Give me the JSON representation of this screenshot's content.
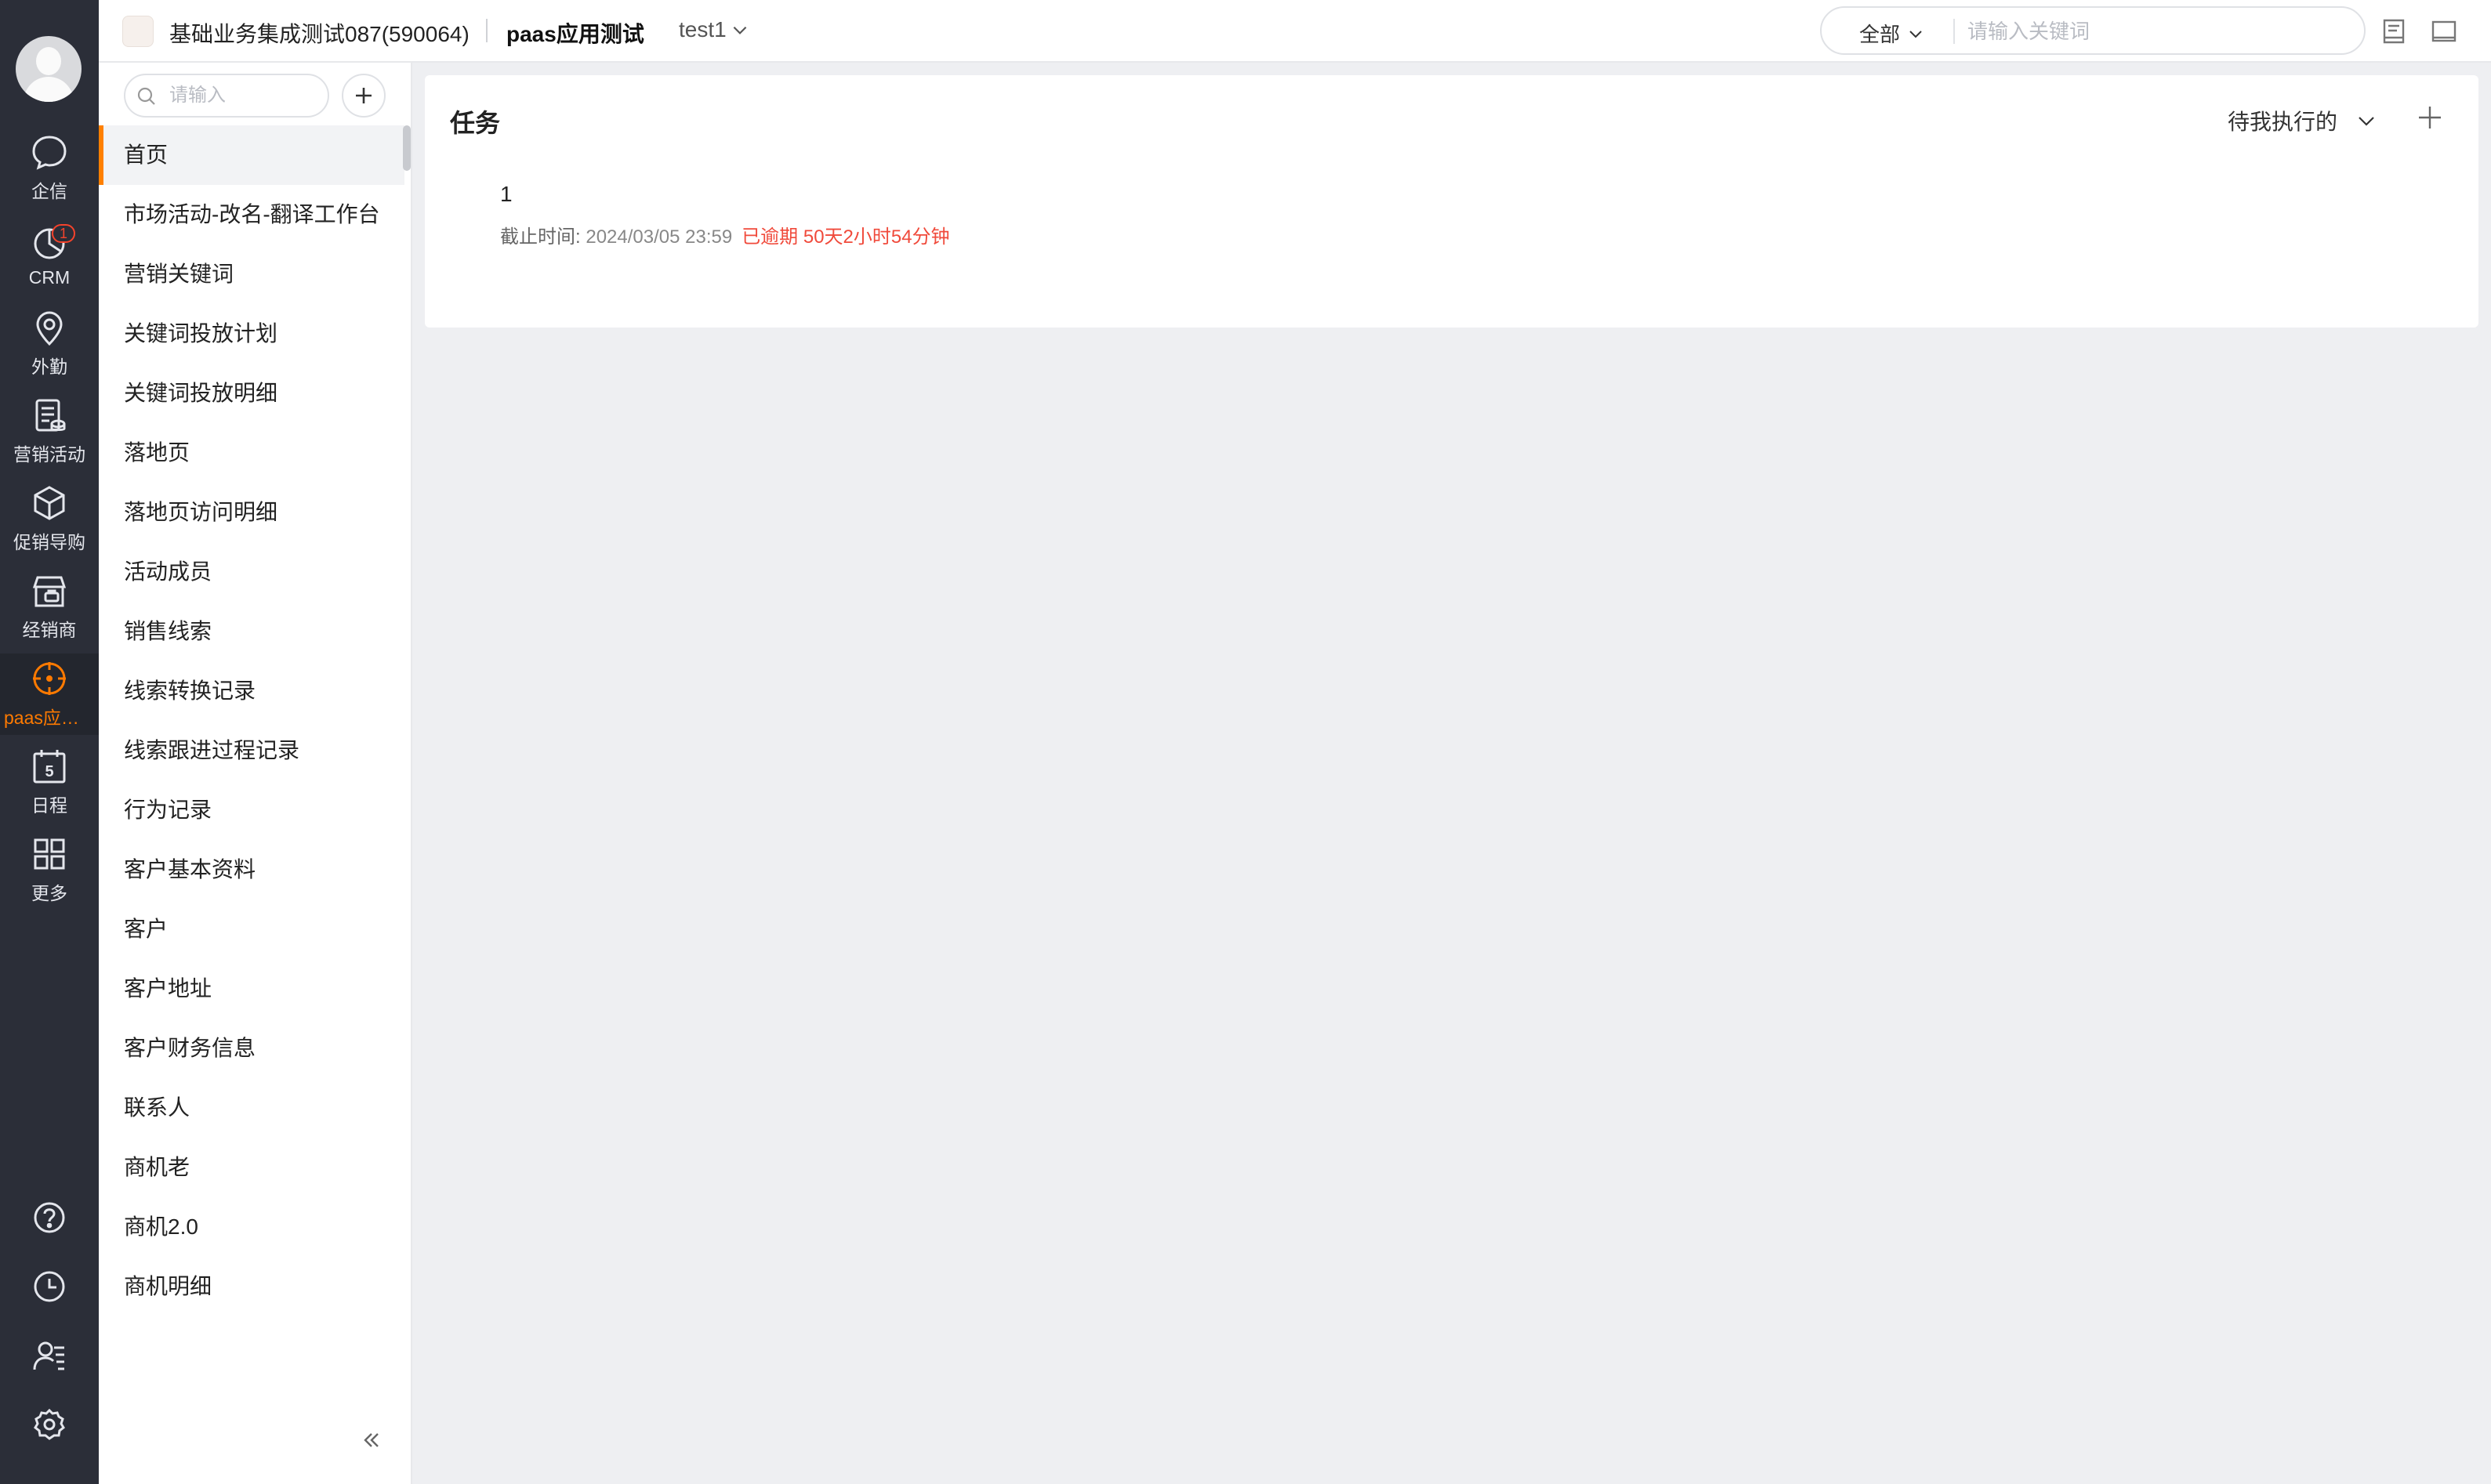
{
  "header": {
    "company": "基础业务集成测试087(590064)",
    "app_name": "paas应用测试",
    "view_name": "test1",
    "search_scope": "全部",
    "search_placeholder": "请输入关键词"
  },
  "rail": {
    "items": [
      {
        "label": "企信",
        "icon": "chat-icon"
      },
      {
        "label": "CRM",
        "icon": "pie-chart-icon",
        "badge": "1"
      },
      {
        "label": "外勤",
        "icon": "location-pin-icon"
      },
      {
        "label": "营销活动",
        "icon": "document-stack-icon"
      },
      {
        "label": "促销导购",
        "icon": "cube-icon"
      },
      {
        "label": "经销商",
        "icon": "store-icon"
      },
      {
        "label": "paas应用测试",
        "icon": "crosshair-icon",
        "active": true
      },
      {
        "label": "日程",
        "icon": "calendar-icon",
        "day": "5"
      },
      {
        "label": "更多",
        "icon": "grid-icon"
      }
    ],
    "bottom_icons": [
      "help-icon",
      "clock-icon",
      "contacts-icon",
      "settings-icon"
    ]
  },
  "subnav": {
    "search_placeholder": "请输入",
    "items": [
      {
        "label": "首页",
        "active": true
      },
      {
        "label": "市场活动-改名-翻译工作台"
      },
      {
        "label": "营销关键词"
      },
      {
        "label": "关键词投放计划"
      },
      {
        "label": "关键词投放明细"
      },
      {
        "label": "落地页"
      },
      {
        "label": "落地页访问明细"
      },
      {
        "label": "活动成员"
      },
      {
        "label": "销售线索"
      },
      {
        "label": "线索转换记录"
      },
      {
        "label": "线索跟进过程记录"
      },
      {
        "label": "行为记录"
      },
      {
        "label": "客户基本资料"
      },
      {
        "label": "客户"
      },
      {
        "label": "客户地址"
      },
      {
        "label": "客户财务信息"
      },
      {
        "label": "联系人"
      },
      {
        "label": "商机老"
      },
      {
        "label": "商机2.0"
      },
      {
        "label": "商机明细"
      }
    ]
  },
  "main": {
    "card_title": "任务",
    "filter_label": "待我执行的",
    "task": {
      "name": "1",
      "deadline_label": "截止时间: ",
      "deadline": "2024/03/05 23:59",
      "overdue": "已逾期 50天2小时54分钟"
    }
  },
  "colors": {
    "rail_bg": "#2b2e38",
    "accent": "#ff7a00",
    "overdue": "#f04a3b",
    "page_bg": "#eeeff2"
  }
}
